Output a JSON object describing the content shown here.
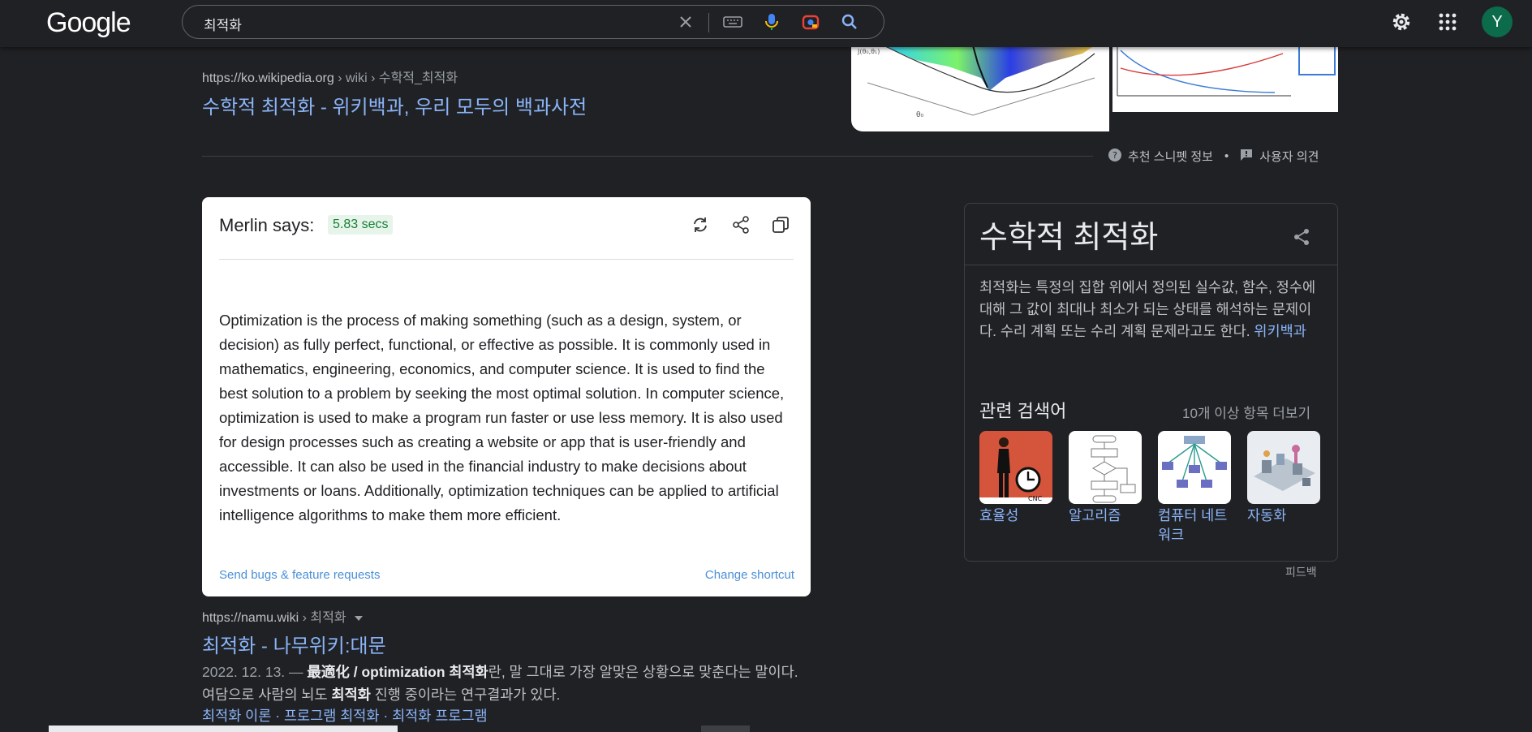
{
  "header": {
    "logo": "Google",
    "query": "최적화",
    "avatar_letter": "Y"
  },
  "result1": {
    "url_base": "https://ko.wikipedia.org",
    "url_path": " › wiki › 수학적_최적화",
    "title": "수학적 최적화 - 위키백과, 우리 모두의 백과사전"
  },
  "snippet_bar": {
    "info": "추천 스니펫 정보",
    "bullet": "•",
    "feedback": "사용자 의견"
  },
  "merlin": {
    "says": "Merlin says:",
    "time": "5.83 secs",
    "answer": "Optimization is the process of making something (such as a design, system, or decision) as fully perfect, functional, or effective as possible. It is commonly used in mathematics, engineering, economics, and computer science. It is used to find the best solution to a problem by seeking the most optimal solution. In computer science, optimization is used to make a program run faster or use less memory. It is also used for design processes such as creating a website or app that is user-friendly and accessible. It can also be used in the financial industry to make decisions about investments or loans. Additionally, optimization techniques can be applied to artificial intelligence algorithms to make them more efficient.",
    "bugs_link": "Send bugs & feature requests",
    "shortcut_link": "Change shortcut"
  },
  "result2": {
    "url_base": "https://namu.wiki",
    "url_path": " › 최적화",
    "title": "최적화 - 나무위키:대문",
    "date": "2022. 12. 13. — ",
    "desc_1": "最適化 / optimization ",
    "desc_bold": "최적화",
    "desc_2": "란, 말 그대로 가장 알맞은 상황으로 맞춘다는 말이다. 여담으로 사람의 뇌도 ",
    "desc_bold2": "최적화",
    "desc_3": " 진행 중이라는 연구결과가 있다.",
    "sitelinks": [
      "최적화 이론",
      "프로그램 최적화",
      "최적화 프로그램"
    ],
    "sitelink_sep": " · "
  },
  "knowledge_panel": {
    "title": "수학적 최적화",
    "description": "최적화는 특정의 집합 위에서 정의된 실수값, 함수, 정수에 대해 그 값이 최대나 최소가 되는 상태를 해석하는 문제이다. 수리 계획 또는 수리 계획 문제라고도 한다. ",
    "source_link": "위키백과",
    "related_title": "관련 검색어",
    "more": "10개 이상 항목 더보기",
    "related": [
      {
        "label": "효율성",
        "icon": "businesswoman-clock-image"
      },
      {
        "label": "알고리즘",
        "icon": "flowchart-image"
      },
      {
        "label": "컴퓨터 네트워크",
        "icon": "network-diagram-image"
      },
      {
        "label": "자동화",
        "icon": "factory-line-image"
      }
    ],
    "feedback": "피드백"
  }
}
